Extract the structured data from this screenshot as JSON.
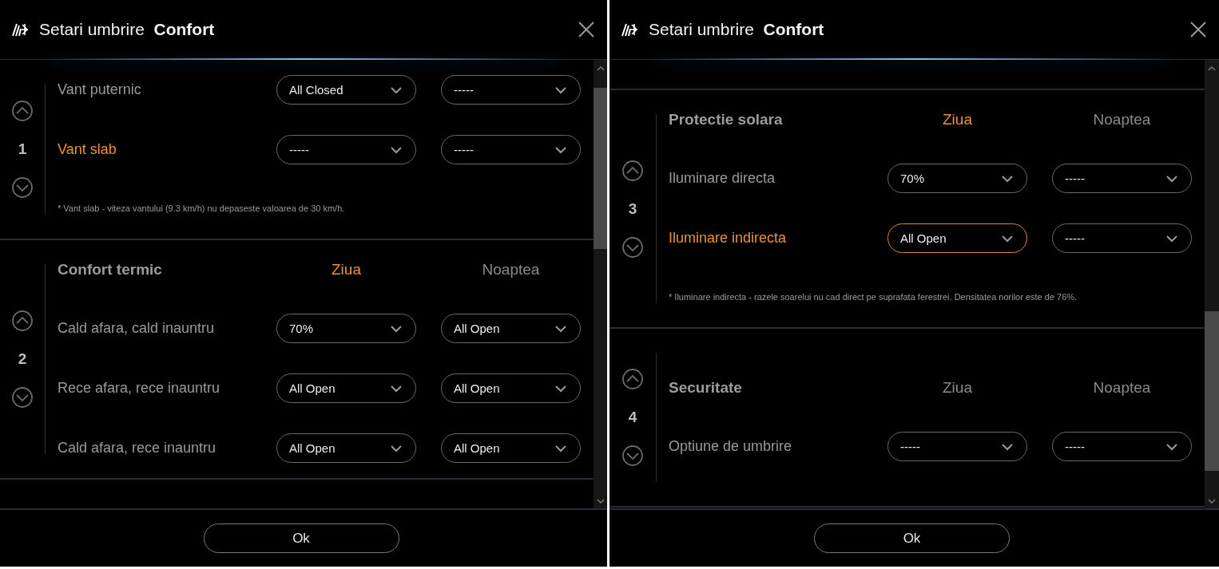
{
  "dialogs": [
    {
      "title": "Setari umbrire  **Confort**",
      "sections": [
        {
          "number": "1",
          "rows": [
            {
              "label": "Vant puternic",
              "highlighted": false,
              "day": {
                "value": "All Closed",
                "highlighted": false
              },
              "night": {
                "value": "-----",
                "highlighted": false
              }
            },
            {
              "label": "Vant slab",
              "highlighted": true,
              "day": {
                "value": "-----",
                "highlighted": false
              },
              "night": {
                "value": "-----",
                "highlighted": false
              }
            }
          ],
          "note": "* Vant slab - viteza vantului (9.3 km/h) nu depaseste valoarea de 30 km/h."
        },
        {
          "number": "2",
          "title": "Confort termic",
          "columns": [
            {
              "label": "Ziua",
              "active": true
            },
            {
              "label": "Noaptea",
              "active": false
            }
          ],
          "rows": [
            {
              "label": "Cald afara, cald inauntru",
              "highlighted": false,
              "day": {
                "value": "70%",
                "highlighted": false
              },
              "night": {
                "value": "All Open",
                "highlighted": false
              }
            },
            {
              "label": "Rece afara, rece inauntru",
              "highlighted": false,
              "day": {
                "value": "All Open",
                "highlighted": false
              },
              "night": {
                "value": "All Open",
                "highlighted": false
              }
            },
            {
              "label": "Cald afara, rece inauntru",
              "highlighted": false,
              "day": {
                "value": "All Open",
                "highlighted": false
              },
              "night": {
                "value": "All Open",
                "highlighted": false
              }
            }
          ]
        }
      ],
      "ok_button": "Ok"
    },
    {
      "title": "Setari umbrire  **Confort**",
      "sections": [
        {
          "number": "3",
          "title": "Protectie solara",
          "columns": [
            {
              "label": "Ziua",
              "active": true
            },
            {
              "label": "Noaptea",
              "active": false
            }
          ],
          "rows": [
            {
              "label": "Iluminare directa",
              "highlighted": false,
              "day": {
                "value": "70%",
                "highlighted": false
              },
              "night": {
                "value": "-----",
                "highlighted": false
              }
            },
            {
              "label": "Iluminare indirecta",
              "highlighted": true,
              "day": {
                "value": "All Open",
                "highlighted": true
              },
              "night": {
                "value": "-----",
                "highlighted": false
              }
            }
          ],
          "note": "* Iluminare indirecta - razele soarelui nu cad direct pe suprafata ferestrei. Densitatea norilor este de 76%."
        },
        {
          "number": "4",
          "title": "Securitate",
          "columns": [
            {
              "label": "Ziua",
              "active": false
            },
            {
              "label": "Noaptea",
              "active": false
            }
          ],
          "rows": [
            {
              "label": "Optiune de umbrire",
              "highlighted": false,
              "day": {
                "value": "-----",
                "highlighted": false
              },
              "night": {
                "value": "-----",
                "highlighted": false
              }
            }
          ]
        }
      ],
      "ok_button": "Ok"
    }
  ]
}
